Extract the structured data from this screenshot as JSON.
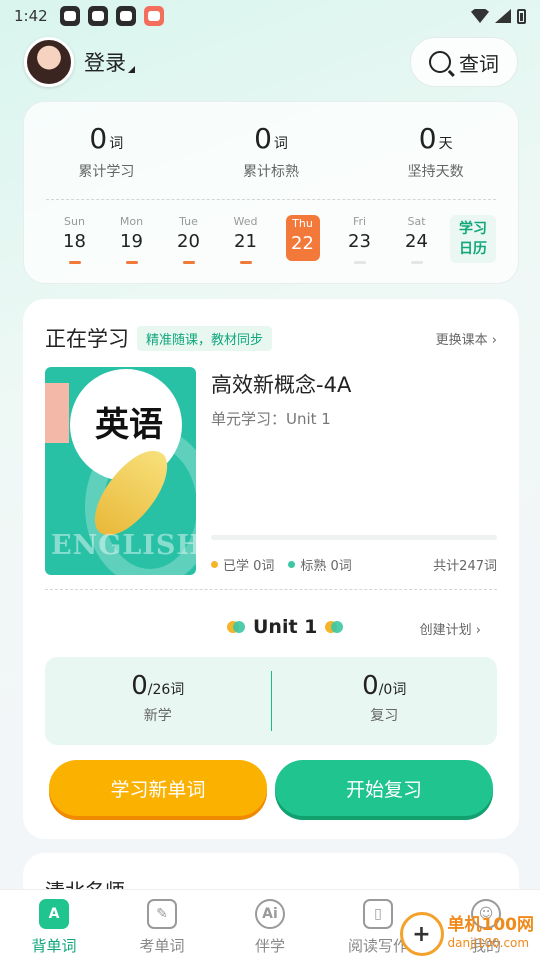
{
  "status_bar": {
    "time": "1:42"
  },
  "header": {
    "login_label": "登录",
    "search_label": "查词"
  },
  "stats": [
    {
      "value": "0",
      "unit": "词",
      "label": "累计学习"
    },
    {
      "value": "0",
      "unit": "词",
      "label": "累计标熟"
    },
    {
      "value": "0",
      "unit": "天",
      "label": "坚持天数"
    }
  ],
  "week": [
    {
      "dow": "Sun",
      "date": "18",
      "studied": true
    },
    {
      "dow": "Mon",
      "date": "19",
      "studied": true
    },
    {
      "dow": "Tue",
      "date": "20",
      "studied": true
    },
    {
      "dow": "Wed",
      "date": "21",
      "studied": true
    },
    {
      "dow": "Thu",
      "date": "22",
      "today": true
    },
    {
      "dow": "Fri",
      "date": "23",
      "studied": false
    },
    {
      "dow": "Sat",
      "date": "24",
      "studied": false
    }
  ],
  "calendar_link": {
    "line1": "学习",
    "line2": "日历"
  },
  "learning": {
    "title": "正在学习",
    "tag": "精准随课，教材同步",
    "change_label": "更换课本 ›",
    "cover_title": "英语",
    "cover_subtitle": "ENGLISH",
    "book_title": "高效新概念-4A",
    "unit_line": "单元学习：Unit 1",
    "progress": 0,
    "learned": "已学 0词",
    "mastered": "标熟 0词",
    "total": "共计247词",
    "colors": {
      "learned_dot": "#f6b42a",
      "mastered_dot": "#3bc7a3"
    }
  },
  "unit": {
    "name": "Unit 1",
    "plan_label": "创建计划 ›",
    "new": {
      "value": "0",
      "of": "/26词",
      "label": "新学"
    },
    "review": {
      "value": "0",
      "of": "/0词",
      "label": "复习"
    }
  },
  "buttons": {
    "learn": "学习新单词",
    "review": "开始复习"
  },
  "teacher_section": {
    "title": "清北名师"
  },
  "nav": [
    {
      "label": "背单词",
      "icon": "A",
      "active": true
    },
    {
      "label": "考单词",
      "icon": "✎"
    },
    {
      "label": "伴学",
      "icon": "Ai"
    },
    {
      "label": "阅读写作",
      "icon": "▯"
    },
    {
      "label": "我的",
      "icon": "☺"
    }
  ],
  "watermark": {
    "logo": "+",
    "line1": "单机100网",
    "line2": "danji100.com"
  }
}
